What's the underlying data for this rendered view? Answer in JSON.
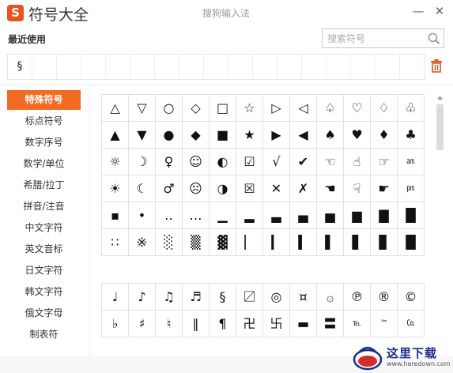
{
  "app": {
    "logo": "S",
    "title": "符号大全",
    "ime_name": "搜狗输入法",
    "minimize": "—",
    "close": "✕"
  },
  "recent": {
    "label": "最近使用",
    "items": [
      "§",
      "",
      "",
      "",
      "",
      "",
      "",
      "",
      "",
      "",
      "",
      "",
      "",
      "",
      "",
      "",
      ""
    ]
  },
  "search": {
    "placeholder": "搜索符号",
    "value": ""
  },
  "sidebar": {
    "items": [
      {
        "label": "特殊符号",
        "active": true
      },
      {
        "label": "标点符号",
        "active": false
      },
      {
        "label": "数字序号",
        "active": false
      },
      {
        "label": "数学/单位",
        "active": false
      },
      {
        "label": "希腊/拉丁",
        "active": false
      },
      {
        "label": "拼音/注音",
        "active": false
      },
      {
        "label": "中文字符",
        "active": false
      },
      {
        "label": "英文音标",
        "active": false
      },
      {
        "label": "日文字符",
        "active": false
      },
      {
        "label": "韩文字符",
        "active": false
      },
      {
        "label": "俄文字母",
        "active": false
      },
      {
        "label": "制表符",
        "active": false
      }
    ]
  },
  "symbols": {
    "group1": [
      [
        "△",
        "▽",
        "○",
        "◇",
        "□",
        "☆",
        "▷",
        "◁",
        "♤",
        "♡",
        "♢",
        "♧"
      ],
      [
        "▲",
        "▼",
        "●",
        "◆",
        "■",
        "★",
        "▶",
        "◀",
        "♠",
        "♥",
        "♦",
        "♣"
      ],
      [
        "☼",
        "☽",
        "♀",
        "☺",
        "◐",
        "☑",
        "√",
        "✔",
        "☜",
        "☝",
        "☞",
        "㏂"
      ],
      [
        "☀",
        "☾",
        "♂",
        "☹",
        "◑",
        "☒",
        "✕",
        "✗",
        "☚",
        "☟",
        "☛",
        "㏘"
      ],
      [
        "▪",
        "•",
        "‥",
        "…",
        "▁",
        "▂",
        "▃",
        "▄",
        "▅",
        "▆",
        "▇",
        "█"
      ],
      [
        "∷",
        "※",
        "░",
        "▒",
        "▓",
        "▏",
        "▎",
        "▍",
        "▌",
        "▋",
        "▊",
        "█"
      ]
    ],
    "group2": [
      [
        "♩",
        "♪",
        "♫",
        "♬",
        "§",
        "〼",
        "◎",
        "¤",
        "۞",
        "℗",
        "®",
        "©"
      ],
      [
        "♭",
        "♯",
        "♮",
        "‖",
        "¶",
        "卍",
        "卐",
        "▬",
        "〓",
        "℡",
        "™",
        "㏇"
      ]
    ]
  },
  "watermark": {
    "text": "这里下载",
    "url": "www.heredown.com"
  },
  "colors": {
    "accent": "#f26b22",
    "logo": "#e8541e",
    "trash": "#e8541e"
  }
}
